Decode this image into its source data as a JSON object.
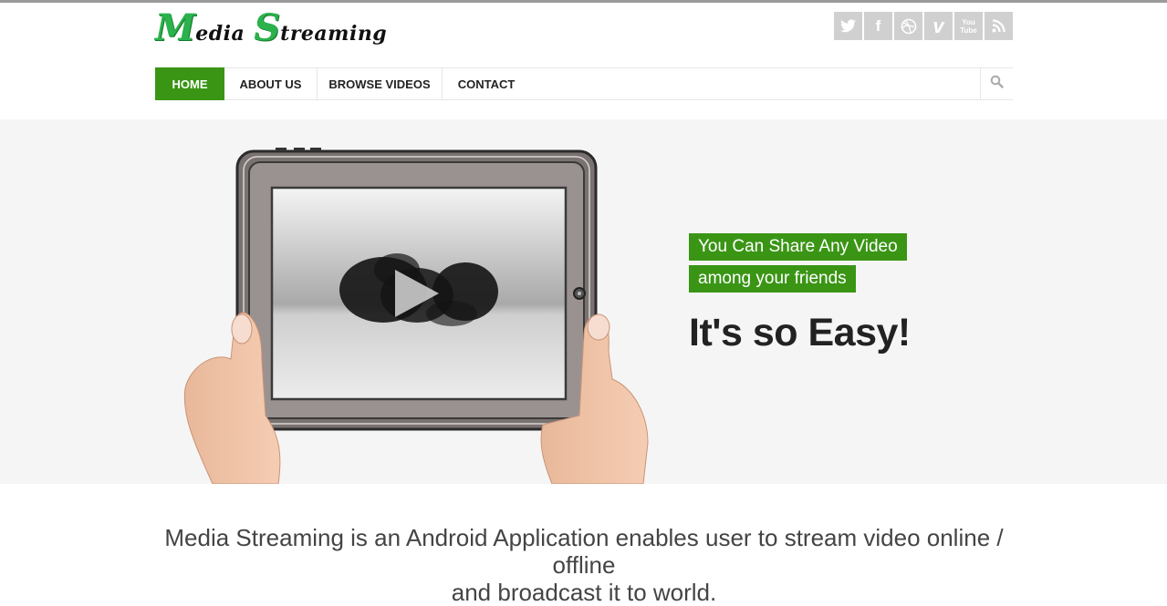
{
  "logo": {
    "word1_cap": "M",
    "word1_rest": "edia",
    "word2_cap": "S",
    "word2_rest": "treaming"
  },
  "social": [
    {
      "icon": "twitter-icon"
    },
    {
      "icon": "facebook-icon",
      "glyph": "f"
    },
    {
      "icon": "dribbble-icon"
    },
    {
      "icon": "vimeo-icon",
      "glyph": "v"
    },
    {
      "icon": "youtube-icon",
      "glyph": "You Tube"
    },
    {
      "icon": "rss-icon"
    }
  ],
  "nav": {
    "items": [
      {
        "label": "HOME",
        "active": true
      },
      {
        "label": "ABOUT US"
      },
      {
        "label": "BROWSE VIDEOS"
      },
      {
        "label": "CONTACT"
      }
    ],
    "search_icon": "search-icon"
  },
  "hero": {
    "tag_line_1": "You Can Share Any Video",
    "tag_line_2": "among your friends",
    "headline": "It's so Easy!"
  },
  "intro": {
    "line1": "Media Streaming is an Android Application enables user to stream video online / offline",
    "line2": "and broadcast it to world."
  },
  "colors": {
    "accent": "#3a9515",
    "logo_green": "#2bb24c",
    "social_bg": "#d0d0d0",
    "hero_bg": "#f5f5f5"
  }
}
